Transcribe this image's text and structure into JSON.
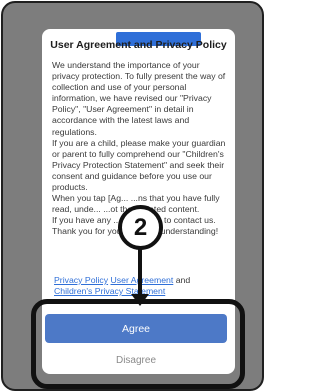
{
  "dialog": {
    "title": "User Agreement and Privacy Policy",
    "body": "We understand the importance of your privacy protection. To fully present the way of collection and use of your personal information, we have revised our \"Privacy Policy\", \"User Agreement\" in detail in accordance with the latest laws and regulations.\nIf you are a child, please make your guardian or parent to fully comprehend our \"Children's Privacy Protection Statement\" and seek their consent and guidance before you use our products.\nWhen you tap [Ag... ...ns that you have fully read, unde... ...ot the updated content.\nIf you have any ... ...feel free to contact us.\nThank you for your ... ...and understanding!",
    "links": {
      "privacy_policy": "Privacy Policy",
      "user_agreement": "User Agreement",
      "and": "and",
      "children_statement": "Children's Privacy Statement"
    },
    "agree_label": "Agree",
    "disagree_label": "Disagree"
  },
  "annotation": {
    "step_number": "2"
  },
  "colors": {
    "accent": "#4d79c7",
    "overlay": "#7d7d7d",
    "annotation": "#111111"
  }
}
